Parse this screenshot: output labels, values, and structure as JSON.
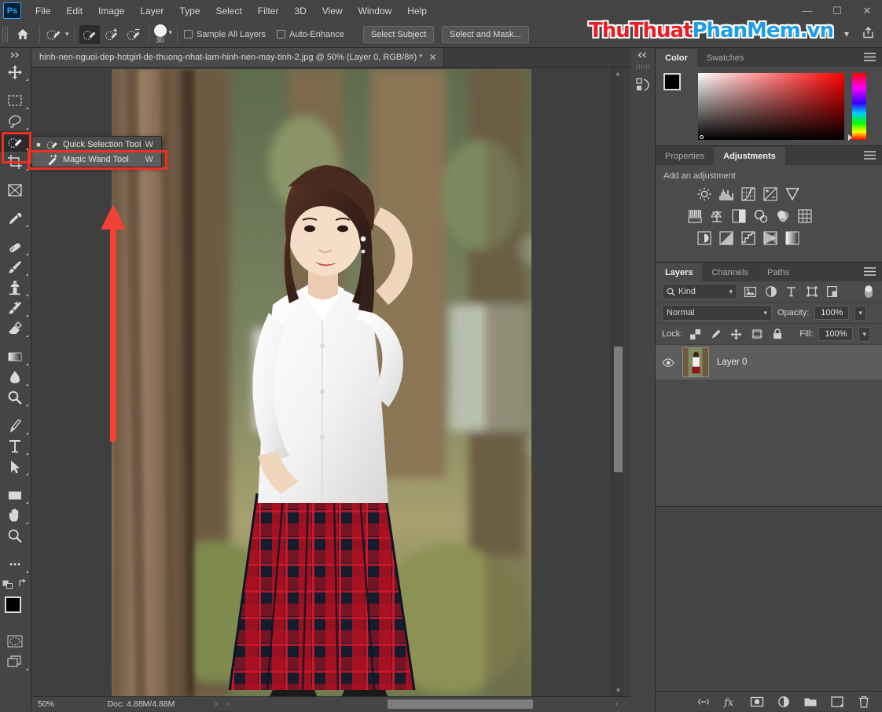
{
  "app": {
    "logo": "Ps"
  },
  "titlebar": {
    "menus": [
      "File",
      "Edit",
      "Image",
      "Layer",
      "Type",
      "Select",
      "Filter",
      "3D",
      "View",
      "Window",
      "Help"
    ],
    "window_controls": [
      {
        "name": "minimize-button",
        "glyph": "—"
      },
      {
        "name": "maximize-button",
        "glyph": "☐"
      },
      {
        "name": "close-button",
        "glyph": "✕"
      }
    ]
  },
  "options_bar": {
    "home_icon": "home-icon",
    "tool_preset_icon": "quick-selection-preset-icon",
    "modes": [
      {
        "name": "new-selection-mode",
        "icon": "brush-selection-icon",
        "active": true
      },
      {
        "name": "add-to-selection-mode",
        "icon": "brush-plus-icon",
        "active": false
      },
      {
        "name": "subtract-from-selection-mode",
        "icon": "brush-minus-icon",
        "active": false
      }
    ],
    "brush_size": "30",
    "checkboxes": [
      {
        "label": "Sample All Layers",
        "checked": false
      },
      {
        "label": "Auto-Enhance",
        "checked": false
      }
    ],
    "select_subject_label": "Select Subject",
    "select_and_mask_label": "Select and Mask...",
    "share_icon": "share-icon"
  },
  "watermark": {
    "part1": "ThuThuat",
    "part2": "PhanMem",
    "part3": ".vn",
    "color_red": "#ed1c24",
    "color_blue": "#1f9de8"
  },
  "toolbar": {
    "expand_icon": "double-chevron-right-icon",
    "tools": [
      {
        "name": "move-tool",
        "icon": "move-icon",
        "selected": false,
        "has_flyout": true
      },
      {
        "name": "rectangular-marquee-tool",
        "icon": "marquee-icon",
        "selected": false,
        "has_flyout": true
      },
      {
        "name": "lasso-tool",
        "icon": "lasso-icon",
        "selected": false,
        "has_flyout": true
      },
      {
        "name": "quick-selection-tool",
        "icon": "quick-selection-icon",
        "selected": true,
        "has_flyout": true
      },
      {
        "name": "crop-tool",
        "icon": "crop-icon",
        "selected": false,
        "has_flyout": true
      },
      {
        "name": "frame-tool",
        "icon": "frame-icon",
        "selected": false,
        "has_flyout": false
      },
      {
        "name": "eyedropper-tool",
        "icon": "eyedropper-icon",
        "selected": false,
        "has_flyout": true
      },
      {
        "name": "spot-healing-brush-tool",
        "icon": "healing-brush-icon",
        "selected": false,
        "has_flyout": true
      },
      {
        "name": "brush-tool",
        "icon": "brush-icon",
        "selected": false,
        "has_flyout": true
      },
      {
        "name": "clone-stamp-tool",
        "icon": "clone-stamp-icon",
        "selected": false,
        "has_flyout": true
      },
      {
        "name": "history-brush-tool",
        "icon": "history-brush-icon",
        "selected": false,
        "has_flyout": true
      },
      {
        "name": "eraser-tool",
        "icon": "eraser-icon",
        "selected": false,
        "has_flyout": true
      },
      {
        "name": "gradient-tool",
        "icon": "gradient-icon",
        "selected": false,
        "has_flyout": true
      },
      {
        "name": "blur-tool",
        "icon": "blur-drop-icon",
        "selected": false,
        "has_flyout": true
      },
      {
        "name": "dodge-tool",
        "icon": "dodge-icon",
        "selected": false,
        "has_flyout": true
      },
      {
        "name": "pen-tool",
        "icon": "pen-icon",
        "selected": false,
        "has_flyout": true
      },
      {
        "name": "type-tool",
        "icon": "type-t-icon",
        "selected": false,
        "has_flyout": true
      },
      {
        "name": "path-selection-tool",
        "icon": "path-arrow-icon",
        "selected": false,
        "has_flyout": true
      },
      {
        "name": "rectangle-tool",
        "icon": "rectangle-icon",
        "selected": false,
        "has_flyout": true
      },
      {
        "name": "hand-tool",
        "icon": "hand-icon",
        "selected": false,
        "has_flyout": true
      },
      {
        "name": "zoom-tool",
        "icon": "magnifier-icon",
        "selected": false,
        "has_flyout": false
      },
      {
        "name": "edit-toolbar",
        "icon": "ellipsis-icon",
        "selected": false,
        "has_flyout": true
      }
    ],
    "foreground_color": "#000000",
    "background_color": "#ffffff",
    "quick_mask_icon": "quick-mask-icon",
    "screen_mode_icon": "screen-mode-icon",
    "swap_icon": "swap-colors-icon",
    "default_colors_icon": "default-colors-icon"
  },
  "tool_flyout": {
    "items": [
      {
        "label": "Quick Selection Tool",
        "shortcut": "W",
        "icon": "quick-selection-icon",
        "bullet": true,
        "highlighted": false
      },
      {
        "label": "Magic Wand Tool",
        "shortcut": "W",
        "icon": "magic-wand-icon",
        "bullet": false,
        "highlighted": true
      }
    ]
  },
  "document": {
    "tab_title": "hinh-nen-nguoi-dep-hotgirl-de-thuong-nhat-lam-hinh-nen-may-tinh-2.jpg @ 50% (Layer 0, RGB/8#) *",
    "close_glyph": "✕"
  },
  "status_bar": {
    "zoom": "50%",
    "doc_info": "Doc: 4.88M/4.88M",
    "next_glyph": "›",
    "prev_glyph": "‹"
  },
  "collapsed_dock": {
    "collapse_icon": "double-chevron-left-icon",
    "history_icon": "history-icon"
  },
  "color_panel": {
    "tabs": [
      {
        "label": "Color",
        "active": true
      },
      {
        "label": "Swatches",
        "active": false
      }
    ],
    "menu_icon": "panel-menu-icon",
    "foreground": "#000000",
    "background": "#ffffff",
    "hue": "#ff0000"
  },
  "adjustments_panel": {
    "tabs": [
      {
        "label": "Properties",
        "active": false
      },
      {
        "label": "Adjustments",
        "active": true
      }
    ],
    "menu_icon": "panel-menu-icon",
    "heading": "Add an adjustment",
    "row1": [
      "brightness-contrast-icon",
      "levels-icon",
      "curves-icon",
      "exposure-icon",
      "vibrance-icon"
    ],
    "row2": [
      "hue-saturation-icon",
      "color-balance-icon",
      "black-white-icon",
      "photo-filter-icon",
      "channel-mixer-icon",
      "color-lookup-icon"
    ],
    "row3": [
      "invert-icon",
      "posterize-icon",
      "threshold-icon",
      "selective-color-icon",
      "gradient-map-icon"
    ]
  },
  "layers_panel": {
    "tabs": [
      {
        "label": "Layers",
        "active": true
      },
      {
        "label": "Channels",
        "active": false
      },
      {
        "label": "Paths",
        "active": false
      }
    ],
    "menu_icon": "panel-menu-icon",
    "filter_label": "Kind",
    "filter_search_icon": "search-icon",
    "filter_icons": [
      "pixel-layer-filter-icon",
      "adjustment-layer-filter-icon",
      "type-layer-filter-icon",
      "shape-layer-filter-icon",
      "smart-object-filter-icon"
    ],
    "filter_toggle_icon": "filter-toggle-icon",
    "blend_mode": "Normal",
    "opacity_label": "Opacity:",
    "opacity_value": "100%",
    "lock_label": "Lock:",
    "lock_icons": [
      "lock-transparent-pixels-icon",
      "lock-image-pixels-icon",
      "lock-position-icon",
      "lock-artboard-icon",
      "lock-all-icon"
    ],
    "fill_label": "Fill:",
    "fill_value": "100%",
    "layers": [
      {
        "name": "Layer 0",
        "visible": true,
        "selected": true
      }
    ],
    "footer_icons": [
      "link-layers-icon",
      "layer-style-fx-icon",
      "add-layer-mask-icon",
      "new-adjustment-layer-icon",
      "new-group-icon",
      "new-layer-icon",
      "delete-layer-icon"
    ]
  },
  "annotations": {
    "tool_highlight": "red-rectangle-around-quick-selection-tool",
    "menu_highlight": "red-rectangle-around-magic-wand-tool",
    "arrow": "red-arrow-pointing-up",
    "arrow_color": "#ee3124"
  }
}
